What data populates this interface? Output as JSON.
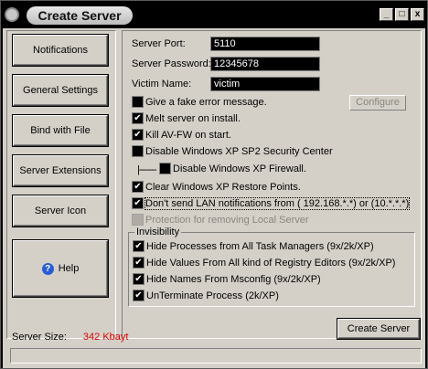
{
  "window": {
    "title": "Create Server",
    "minimize": "_",
    "maximize": "□",
    "close": "x"
  },
  "nav": {
    "items": [
      {
        "label": "Notifications"
      },
      {
        "label": "General Settings"
      },
      {
        "label": "Bind with File"
      },
      {
        "label": "Server Extensions"
      },
      {
        "label": "Server Icon"
      }
    ],
    "help": "Help"
  },
  "settings": {
    "port_label": "Server Port:",
    "port_value": "5110",
    "password_label": "Server Password:",
    "password_value": "12345678",
    "victim_label": "Victim Name:",
    "victim_value": "victim",
    "configure_label": "Configure",
    "options": [
      {
        "label": "Give a fake error message.",
        "checked": false
      },
      {
        "label": "Melt server on install.",
        "checked": true
      },
      {
        "label": "Kill AV-FW on start.",
        "checked": true
      },
      {
        "label": "Disable Windows XP SP2 Security Center",
        "checked": false
      },
      {
        "label": "Disable Windows XP Firewall.",
        "checked": false
      },
      {
        "label": "Clear Windows XP Restore Points.",
        "checked": true
      },
      {
        "label": "Don't send LAN notifications from ( 192.168.*.*) or (10.*.*.*)",
        "checked": true
      },
      {
        "label": "Protection for removing Local Server",
        "checked": false,
        "disabled": true
      }
    ],
    "tree_connector": "|-------"
  },
  "invisibility": {
    "title": "Invisibility",
    "options": [
      {
        "label": "Hide Processes from All Task Managers  (9x/2k/XP)",
        "checked": true
      },
      {
        "label": "Hide Values From All kind of Registry Editors (9x/2k/XP)",
        "checked": true
      },
      {
        "label": "Hide Names From Msconfig  (9x/2k/XP)",
        "checked": true
      },
      {
        "label": "UnTerminate Process (2k/XP)",
        "checked": true
      }
    ]
  },
  "footer": {
    "size_label": "Server Size:",
    "size_value": "342 Kbayt",
    "create_button": "Create Server"
  },
  "colors": {
    "size_value": "#e00000",
    "face": "#d4d0c8"
  }
}
